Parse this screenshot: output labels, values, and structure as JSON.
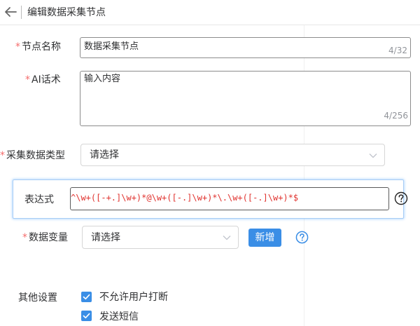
{
  "header": {
    "title": "编辑数据采集节点"
  },
  "form": {
    "node_name": {
      "label": "节点名称",
      "value": "数据采集节点",
      "counter": "4/32"
    },
    "ai_script": {
      "label": "AI话术",
      "value": "输入内容",
      "counter": "4/256"
    },
    "data_type": {
      "label": "采集数据类型",
      "selected": "请选择"
    },
    "expression": {
      "label": "表达式",
      "value": "^\\w+([-+.]\\w+)*@\\w+([-.]\\w+)*\\.\\w+([-.]\\w+)*$"
    },
    "data_variable": {
      "label": "数据变量",
      "selected": "请选择",
      "add_label": "新增"
    },
    "other": {
      "label": "其他设置",
      "options": [
        {
          "label": "不允许用户打断",
          "checked": true
        },
        {
          "label": "发送短信",
          "checked": true
        }
      ]
    }
  },
  "required_mark": "*",
  "colors": {
    "accent": "#3a8ee6",
    "required": "#f56c6c",
    "expression_text": "#e0322e",
    "focus_border": "#a7ccf5"
  },
  "icons": {
    "back": "arrow-left-icon",
    "chevron": "chevron-down-icon",
    "help": "question-circle-icon",
    "check": "check-icon"
  }
}
